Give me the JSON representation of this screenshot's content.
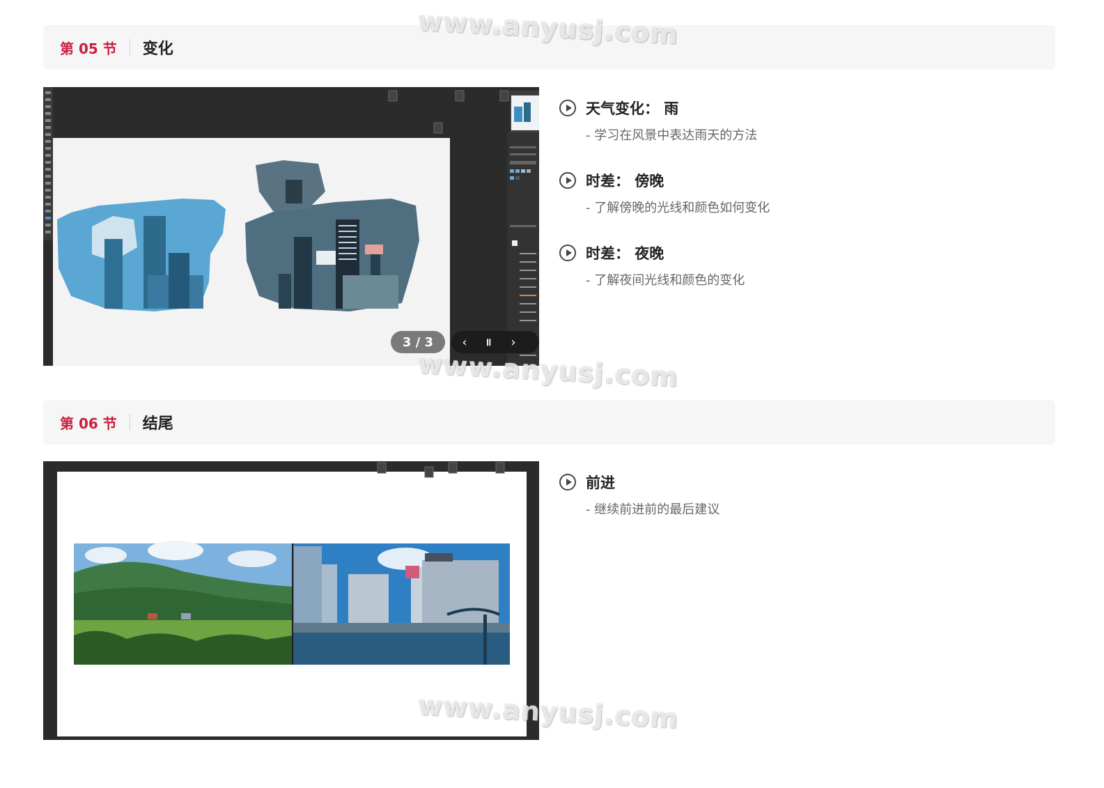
{
  "sections": [
    {
      "number": "第 05 节",
      "title": "变化",
      "slide_counter": "3 / 3",
      "lessons": [
        {
          "title": "天气变化： 雨",
          "desc": "- 学习在风景中表达雨天的方法"
        },
        {
          "title": "时差： 傍晚",
          "desc": "- 了解傍晚的光线和颜色如何变化"
        },
        {
          "title": "时差： 夜晚",
          "desc": "- 了解夜间光线和颜色的变化"
        }
      ]
    },
    {
      "number": "第 06 节",
      "title": "结尾",
      "lessons": [
        {
          "title": "前进",
          "desc": "- 继续前进前的最后建议"
        }
      ]
    }
  ],
  "watermark": "www.anyusj.com",
  "colors": {
    "accent": "#c8203e",
    "header_bg": "#f6f6f6",
    "app_dark": "#2b2b2b"
  }
}
